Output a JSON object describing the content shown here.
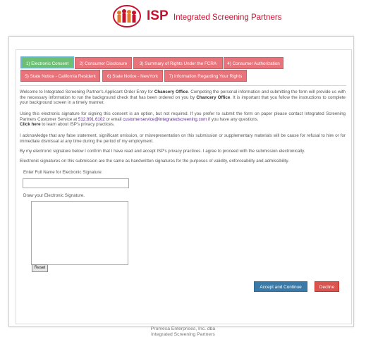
{
  "header": {
    "logo_letters": "ISP",
    "brand_name": "Integrated Screening Partners",
    "brand_color": "#c8102e"
  },
  "tabs": [
    {
      "label": "1) Electronic Consent",
      "active": true
    },
    {
      "label": "2) Consumer Disclosure",
      "active": false
    },
    {
      "label": "3) Summary of Rights Under the FCRA",
      "active": false
    },
    {
      "label": "4) Consumer Authorization",
      "active": false
    },
    {
      "label": "5) State Notice - California Resident",
      "active": false
    },
    {
      "label": "6) State Notice - NewYork",
      "active": false
    },
    {
      "label": "7) Information Regarding Your Rights",
      "active": false
    }
  ],
  "content": {
    "p1_a": "Welcome to Integrated Screening Partner's Applicant Order Entry for ",
    "company": "Chancery Office",
    "p1_b": ". Competing the personal information and submitting the form will provide us with the necessary information to run the background check that has been ordered on you by ",
    "p1_c": ". It is important that you follow the instructions to complete your background screen in a timely manner.",
    "p2_a": "Using this electronic signature for signing this consent is an option, but not required. If you prefer to submit the form on paper please contact Integrated Screening Partners Customer Service at ",
    "phone": "512.891.6102",
    "p2_b": " or email ",
    "email": "customerservice@integratedscreening.com",
    "p2_c": " if you have any questions.",
    "click_here": "Click here",
    "p2_d": " to learn about ISP's privacy practices.",
    "p3": "I acknowledge that any false statement, significant omission, or misrepresentation on this submission or supplementary materials will be cause for refusal to hire or for immediate dismissal at any time during the period of my employment.",
    "p4": "By my electronic signature below I confirm that I have read and accept ISP's privacy practices. I agree to proceed with the submission electronically.",
    "p5": "Electronic signatures on this submission are the same as handwritten signatures for the purposes of validity, enforceability and admissibility."
  },
  "form": {
    "full_name_label": "Enter Full Name for Electronic Signature:",
    "full_name_value": "",
    "signature_label": "Draw your Electronic Signature.",
    "reset_label": "Reset"
  },
  "actions": {
    "accept_label": "Accept and Continue",
    "decline_label": "Decline"
  },
  "footer": {
    "line1": "Promesa Enterprises, Inc. dba",
    "line2": "Integrated Screening Partners"
  }
}
